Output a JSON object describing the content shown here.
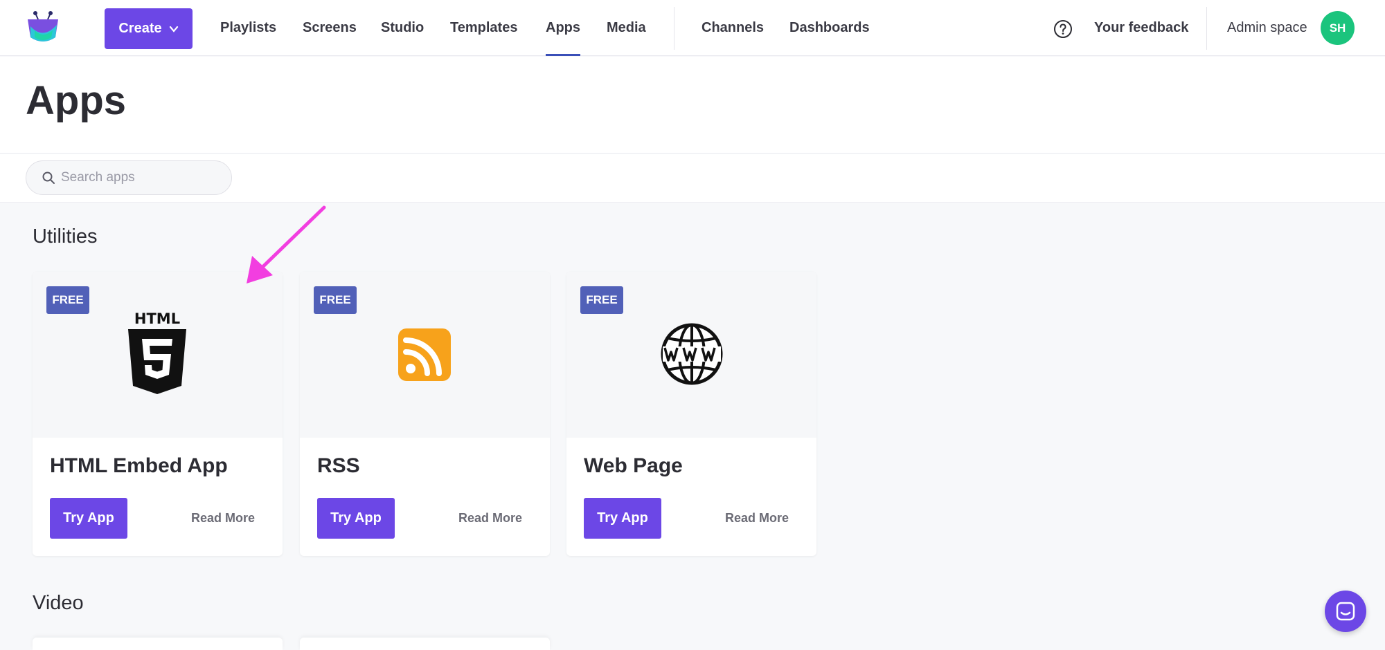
{
  "nav": {
    "create_label": "Create",
    "items": [
      "Playlists",
      "Screens",
      "Studio",
      "Templates",
      "Apps",
      "Media"
    ],
    "items_right": [
      "Channels",
      "Dashboards"
    ],
    "active": "Apps",
    "feedback_label": "Your feedback",
    "admin_label": "Admin space",
    "avatar_initials": "SH"
  },
  "page": {
    "title": "Apps",
    "search_placeholder": "Search apps"
  },
  "sections": [
    {
      "title": "Utilities",
      "apps": [
        {
          "badge": "FREE",
          "name": "HTML Embed App",
          "icon": "html5-icon",
          "try_label": "Try App",
          "more_label": "Read More"
        },
        {
          "badge": "FREE",
          "name": "RSS",
          "icon": "rss-icon",
          "try_label": "Try App",
          "more_label": "Read More"
        },
        {
          "badge": "FREE",
          "name": "Web Page",
          "icon": "www-globe-icon",
          "try_label": "Try App",
          "more_label": "Read More"
        }
      ]
    },
    {
      "title": "Video"
    }
  ],
  "colors": {
    "primary": "#6c47e6",
    "badge": "#5160b8",
    "avatar": "#1bc47d",
    "rss": "#f7a21b",
    "annotation_arrow": "#f23ee0"
  },
  "html_icon_text": "HTML"
}
